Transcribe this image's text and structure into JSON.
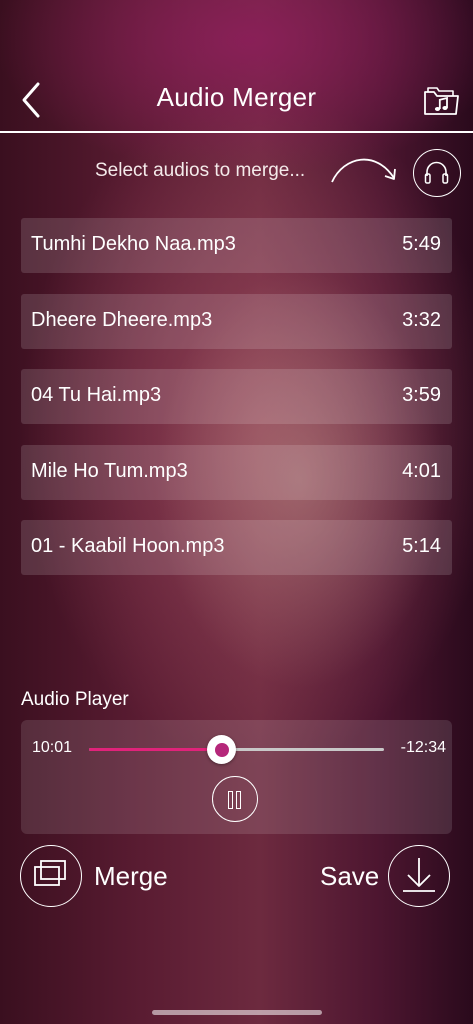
{
  "header": {
    "title": "Audio Merger",
    "back_icon": "chevron-left-icon",
    "folder_icon": "music-folder-icon"
  },
  "hint": {
    "text": "Select audios to merge...",
    "arrow_icon": "curved-arrow-icon",
    "headphones_icon": "headphones-icon"
  },
  "tracks": [
    {
      "name": "Tumhi Dekho Naa.mp3",
      "duration": "5:49"
    },
    {
      "name": "Dheere Dheere.mp3",
      "duration": "3:32"
    },
    {
      "name": "04 Tu Hai.mp3",
      "duration": "3:59"
    },
    {
      "name": "Mile Ho Tum.mp3",
      "duration": "4:01"
    },
    {
      "name": "01 - Kaabil Hoon.mp3",
      "duration": "5:14"
    }
  ],
  "player": {
    "label": "Audio Player",
    "elapsed": "10:01",
    "remaining": "-12:34",
    "progress": 0.45,
    "pause_icon": "pause-icon"
  },
  "actions": {
    "merge_label": "Merge",
    "merge_icon": "merge-icon",
    "save_label": "Save",
    "save_icon": "download-icon"
  },
  "colors": {
    "accent": "#e0237a",
    "thumb_dot": "#b5277a"
  }
}
